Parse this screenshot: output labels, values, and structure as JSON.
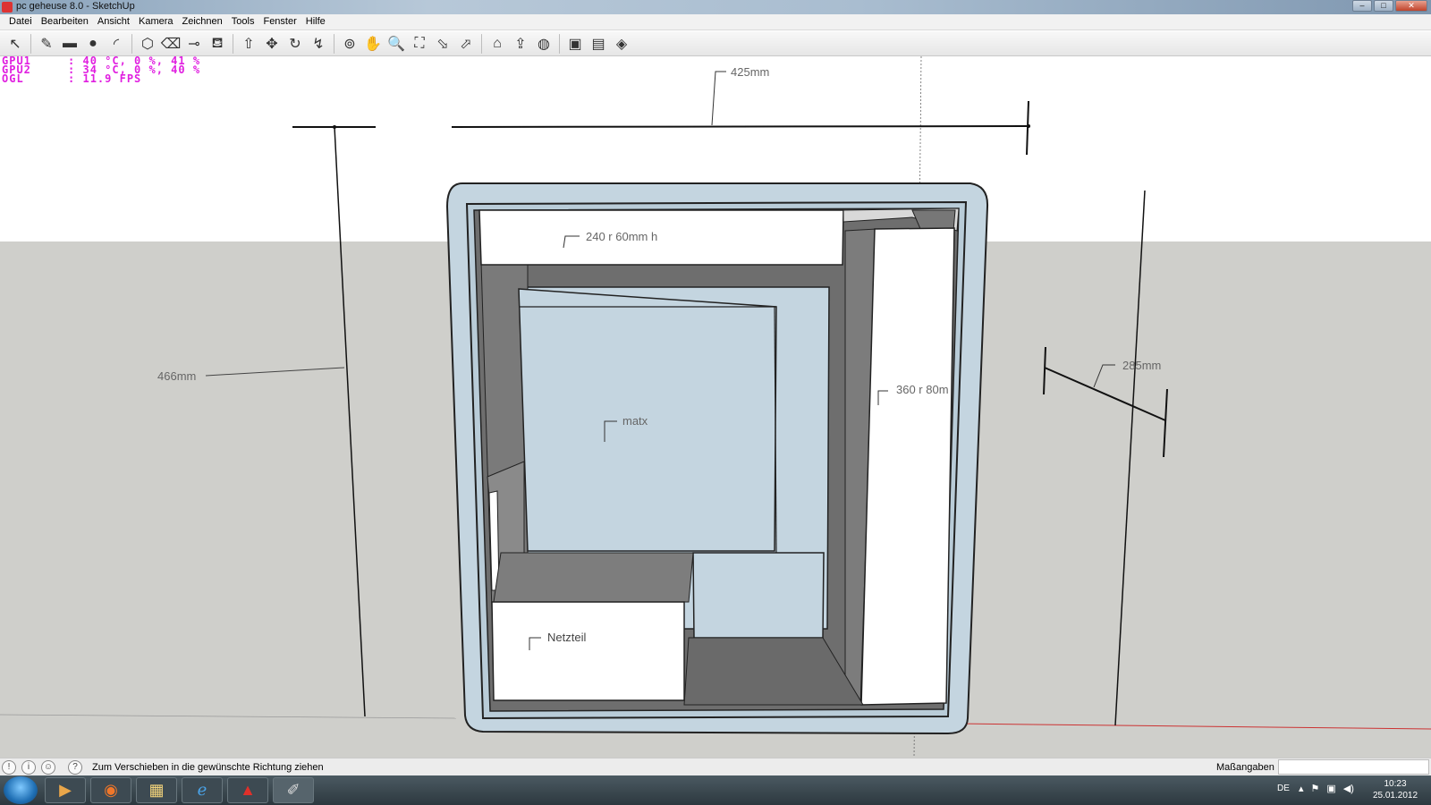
{
  "window": {
    "title": "pc geheuse 8.0 - SketchUp",
    "controls": [
      "–",
      "□",
      "✕"
    ]
  },
  "menu": [
    "Datei",
    "Bearbeiten",
    "Ansicht",
    "Kamera",
    "Zeichnen",
    "Tools",
    "Fenster",
    "Hilfe"
  ],
  "toolbar": [
    {
      "name": "select-tool-icon",
      "glyph": "↖"
    },
    {
      "name": "pencil-line-tool-icon",
      "glyph": "✎"
    },
    {
      "name": "rectangle-tool-icon",
      "glyph": "▬"
    },
    {
      "name": "circle-tool-icon",
      "glyph": "●"
    },
    {
      "name": "arc-tool-icon",
      "glyph": "◜"
    },
    {
      "name": "make-component-icon",
      "glyph": "⬡"
    },
    {
      "name": "eraser-tool-icon",
      "glyph": "⌫"
    },
    {
      "name": "tape-measure-icon",
      "glyph": "⊸"
    },
    {
      "name": "paint-bucket-icon",
      "glyph": "⛾"
    },
    {
      "name": "push-pull-icon",
      "glyph": "⇧"
    },
    {
      "name": "move-tool-icon",
      "glyph": "✥"
    },
    {
      "name": "rotate-tool-icon",
      "glyph": "↻"
    },
    {
      "name": "offset-tool-icon",
      "glyph": "↯"
    },
    {
      "name": "orbit-icon",
      "glyph": "⊚"
    },
    {
      "name": "pan-icon",
      "glyph": "✋"
    },
    {
      "name": "zoom-icon",
      "glyph": "🔍"
    },
    {
      "name": "zoom-extents-icon",
      "glyph": "⛶"
    },
    {
      "name": "previous-view-icon",
      "glyph": "⬂"
    },
    {
      "name": "next-view-icon",
      "glyph": "⬀"
    },
    {
      "name": "get-models-icon",
      "glyph": "⌂"
    },
    {
      "name": "share-model-icon",
      "glyph": "⇪"
    },
    {
      "name": "google-earth-icon",
      "glyph": "◍"
    },
    {
      "name": "get-component-icon",
      "glyph": "▣"
    },
    {
      "name": "share-component-icon",
      "glyph": "▤"
    },
    {
      "name": "extension-warehouse-icon",
      "glyph": "◈"
    }
  ],
  "hud": "GPU1     : 40 °C, 0 %, 41 %\nGPU2     : 34 °C, 0 %, 40 %\nOGL      : 11.9 FPS",
  "labels": {
    "width": "425mm",
    "height": "466mm",
    "depth": "285mm",
    "top_radiator": "240 r 60mm h",
    "side_radiator": "360 r 80m",
    "mainboard": "matx",
    "psu": "Netzteil"
  },
  "status": {
    "hint": "Zum Verschieben in die gewünschte Richtung ziehen",
    "vcb_label": "Maßangaben",
    "vcb_value": ""
  },
  "taskbar": {
    "apps": [
      {
        "name": "media-player-icon",
        "glyph": "▶"
      },
      {
        "name": "firefox-icon",
        "glyph": "◉"
      },
      {
        "name": "explorer-icon",
        "glyph": "▦"
      },
      {
        "name": "internet-explorer-icon",
        "glyph": "ℯ"
      },
      {
        "name": "acrobat-icon",
        "glyph": "▲"
      },
      {
        "name": "sketchup-icon",
        "glyph": "✐"
      }
    ],
    "lang": "DE",
    "time": "10:23",
    "date": "25.01.2012"
  },
  "colors": {
    "case_fill": "#c4d5e0",
    "case_inner": "#b9ccd8",
    "dark_face": "#6a6a6a",
    "mid_face": "#7c7c7c",
    "white_face": "#ffffff",
    "ground": "#cfcfcb",
    "hud": "#e01fe0"
  }
}
